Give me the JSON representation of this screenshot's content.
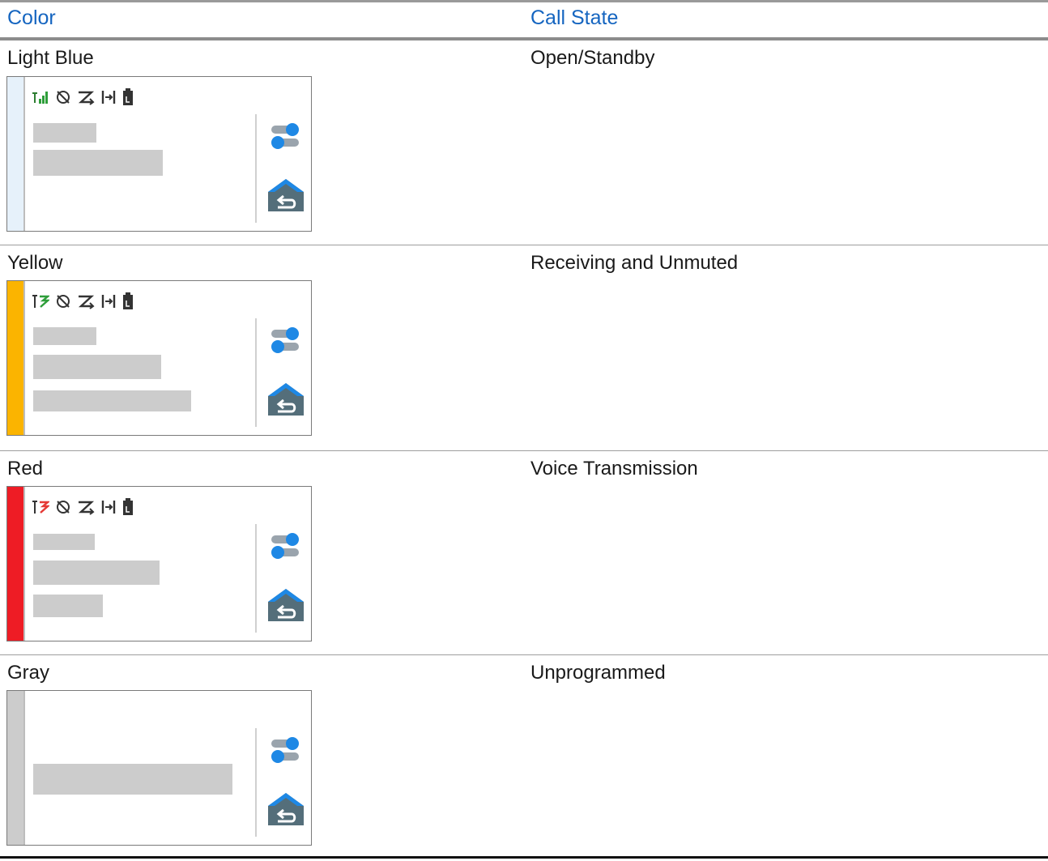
{
  "table": {
    "headers": {
      "color": "Color",
      "call_state": "Call State"
    },
    "rows": [
      {
        "color": "Light Blue",
        "call_state": "Open/Standby",
        "strip_color": "#e6f1fa"
      },
      {
        "color": "Yellow",
        "call_state": "Receiving and Unmuted",
        "strip_color": "#fbb400"
      },
      {
        "color": "Red",
        "call_state": "Voice Transmission",
        "strip_color": "#ee1c25"
      },
      {
        "color": "Gray",
        "call_state": "Unprogrammed",
        "strip_color": "#cccccc"
      }
    ]
  },
  "icons": {
    "status_bar": [
      "signal-icon",
      "gps-off-icon",
      "data-off-icon",
      "bluetooth-icon",
      "battery-icon"
    ],
    "side": [
      "toggle-settings-icon",
      "home-return-icon"
    ]
  },
  "colors": {
    "header_text": "#1565c0",
    "icon_blue": "#1e88e5",
    "icon_slate": "#546e7a"
  }
}
